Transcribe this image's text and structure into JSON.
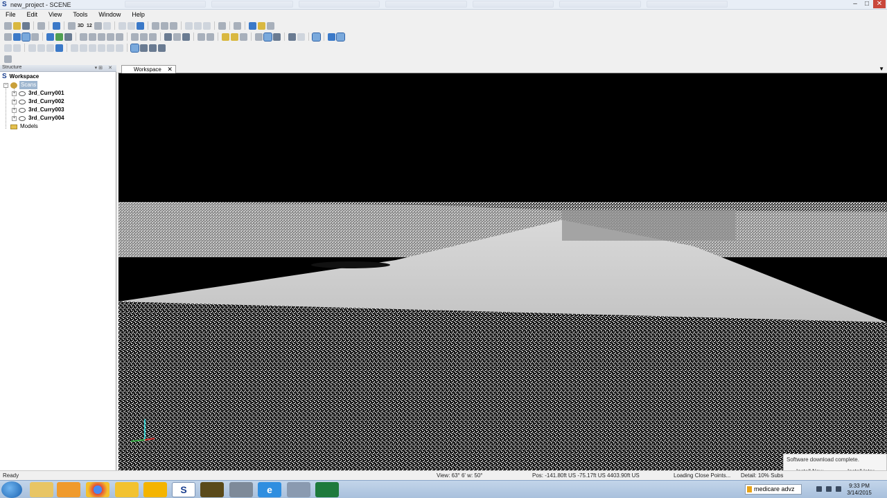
{
  "window": {
    "title": "new_project - SCENE",
    "minimize": "–",
    "maximize": "□",
    "close": "✕"
  },
  "menu": [
    "File",
    "Edit",
    "View",
    "Tools",
    "Window",
    "Help"
  ],
  "toolbar": {
    "label_3d": "3D",
    "label_12": "12"
  },
  "structure": {
    "header": "Structure",
    "pin": "▾ ⊞",
    "close": "✕",
    "root": "Workspace",
    "scans_folder": "Scans",
    "scans": [
      "3rd_Curry001",
      "3rd_Curry002",
      "3rd_Curry003",
      "3rd_Curry004"
    ],
    "models": "Models"
  },
  "tab": {
    "label": "Workspace",
    "close": "✕",
    "menu_arrow": "▼"
  },
  "notification": {
    "message": "Software download complete.",
    "install_now": "Install Now",
    "install_later": "Install later"
  },
  "status": {
    "ready": "Ready",
    "view": "View: 63° 6' w: 50°",
    "pos": "Pos: -141.80ft US -75.17ft US 4403.90ft US",
    "loading": "Loading Close Points...",
    "detail": "Detail:  10%  Subs"
  },
  "taskbar": {
    "search": "medicare advz",
    "time": "9:33 PM",
    "date": "3/14/2015",
    "apps": [
      "explorer-icon",
      "media-player-icon",
      "chrome-icon",
      "norton-icon",
      "sun-icon",
      "scene-icon",
      "video-icon",
      "disk-icon",
      "ie-icon",
      "installer-icon",
      "excel-icon"
    ]
  },
  "colors": {
    "view_background": "#000000",
    "tree_selection": "#9eb6cf",
    "taskbar": "#a8c0dc"
  }
}
